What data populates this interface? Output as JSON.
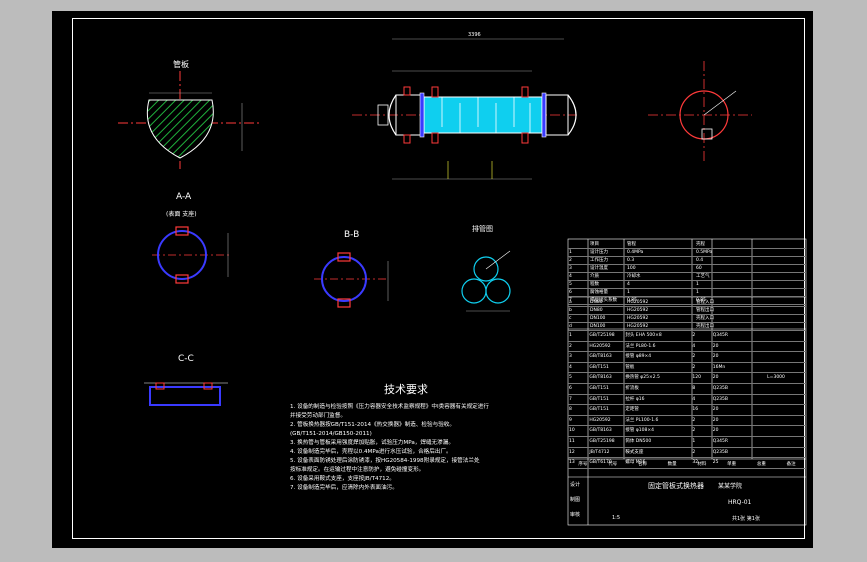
{
  "views": {
    "tube_sheet_label": "管板",
    "section_aa": "A-A",
    "section_aa_note": "(表面 支座)",
    "section_bb": "B-B",
    "section_cc": "C-C",
    "tube_layout_label": "排管图",
    "overall_length": "3396"
  },
  "tech_requirements": {
    "title": "技术要求",
    "items": [
      "1. 设备的制造与检验按照《压力容器安全技术监察规程》中I类容器有关规定进行",
      "   并接受劳动部门监督。",
      "2. 管板换热器按GB/T151-2014《热交换器》制造、检验与验收。",
      "   (GB/T151-2014/GB150-2011)",
      "3. 换热管与管板采用强度焊加贴胀，试验压力MPa，焊缝无渗漏。",
      "4. 设备制造完毕后，壳程以0.4MPa进行水压试验，合格后出厂。",
      "5. 设备表面防锈处理后涂防锈漆，按HG20584-1998附录规定，接管法兰处",
      "   按标准规定。在运输过程中注意防护，避免碰撞变形。",
      "6. 设备采用鞍式支座，支座按JB/T4712。",
      "7. 设备制造完毕后，应清除内外表面油污。"
    ]
  },
  "design_table": {
    "headers": [
      "",
      "项目",
      "管程",
      "壳程"
    ],
    "rows": [
      [
        "1",
        "设计压力",
        "0.4MPa",
        "0.5MPa"
      ],
      [
        "2",
        "工作压力",
        "0.3",
        "0.4"
      ],
      [
        "3",
        "设计温度",
        "100",
        "60"
      ],
      [
        "4",
        "介质",
        "冷却水",
        "工艺气"
      ],
      [
        "5",
        "程数",
        "4",
        "1"
      ],
      [
        "6",
        "腐蚀裕量",
        "1",
        "1"
      ],
      [
        "7",
        "焊接接头系数",
        "0.85",
        "0.85"
      ]
    ]
  },
  "nozzle_table": {
    "headers": [
      "符号",
      "公称尺寸",
      "连接标准",
      "用途"
    ],
    "rows": [
      [
        "a",
        "DN80",
        "HG20592",
        "管程入口"
      ],
      [
        "b",
        "DN80",
        "HG20592",
        "管程出口"
      ],
      [
        "c",
        "DN100",
        "HG20592",
        "壳程入口"
      ],
      [
        "d",
        "DN100",
        "HG20592",
        "壳程出口"
      ]
    ]
  },
  "parts_table": {
    "rows": [
      [
        "1",
        "GB/T25198",
        "封头 EHA 500×8",
        "2",
        "Q345R",
        "",
        ""
      ],
      [
        "2",
        "HG20592",
        "法兰 PL80-1.6",
        "4",
        "20",
        "",
        ""
      ],
      [
        "3",
        "GB/T8163",
        "接管 φ89×4",
        "2",
        "20",
        "",
        ""
      ],
      [
        "4",
        "GB/T151",
        "管板",
        "2",
        "16Mn",
        "",
        ""
      ],
      [
        "5",
        "GB/T8163",
        "换热管 φ25×2.5",
        "120",
        "20",
        "",
        "L=3000"
      ],
      [
        "6",
        "GB/T151",
        "折流板",
        "8",
        "Q235B",
        "",
        ""
      ],
      [
        "7",
        "GB/T151",
        "拉杆 φ16",
        "4",
        "Q235B",
        "",
        ""
      ],
      [
        "8",
        "GB/T151",
        "定距管",
        "16",
        "20",
        "",
        ""
      ],
      [
        "9",
        "HG20592",
        "法兰 PL100-1.6",
        "2",
        "20",
        "",
        ""
      ],
      [
        "10",
        "GB/T8163",
        "接管 φ108×4",
        "2",
        "20",
        "",
        ""
      ],
      [
        "11",
        "GB/T25198",
        "筒体 DN500",
        "1",
        "Q345R",
        "",
        ""
      ],
      [
        "12",
        "JB/T4712",
        "鞍式支座",
        "2",
        "Q235B",
        "",
        ""
      ],
      [
        "13",
        "GB/T6170",
        "螺母 M16",
        "32",
        "25",
        "",
        ""
      ]
    ]
  },
  "title_block": {
    "headers": [
      "序号",
      "代号",
      "名称",
      "数量",
      "材料",
      "单重",
      "总重",
      "备注"
    ],
    "drawing_name": "固定管板式换热器",
    "company": "某某学院",
    "drawing_no": "HRQ-01",
    "scale": "1:5",
    "sheet": "共1张 第1张",
    "labels": [
      "设计",
      "制图",
      "审核"
    ]
  }
}
